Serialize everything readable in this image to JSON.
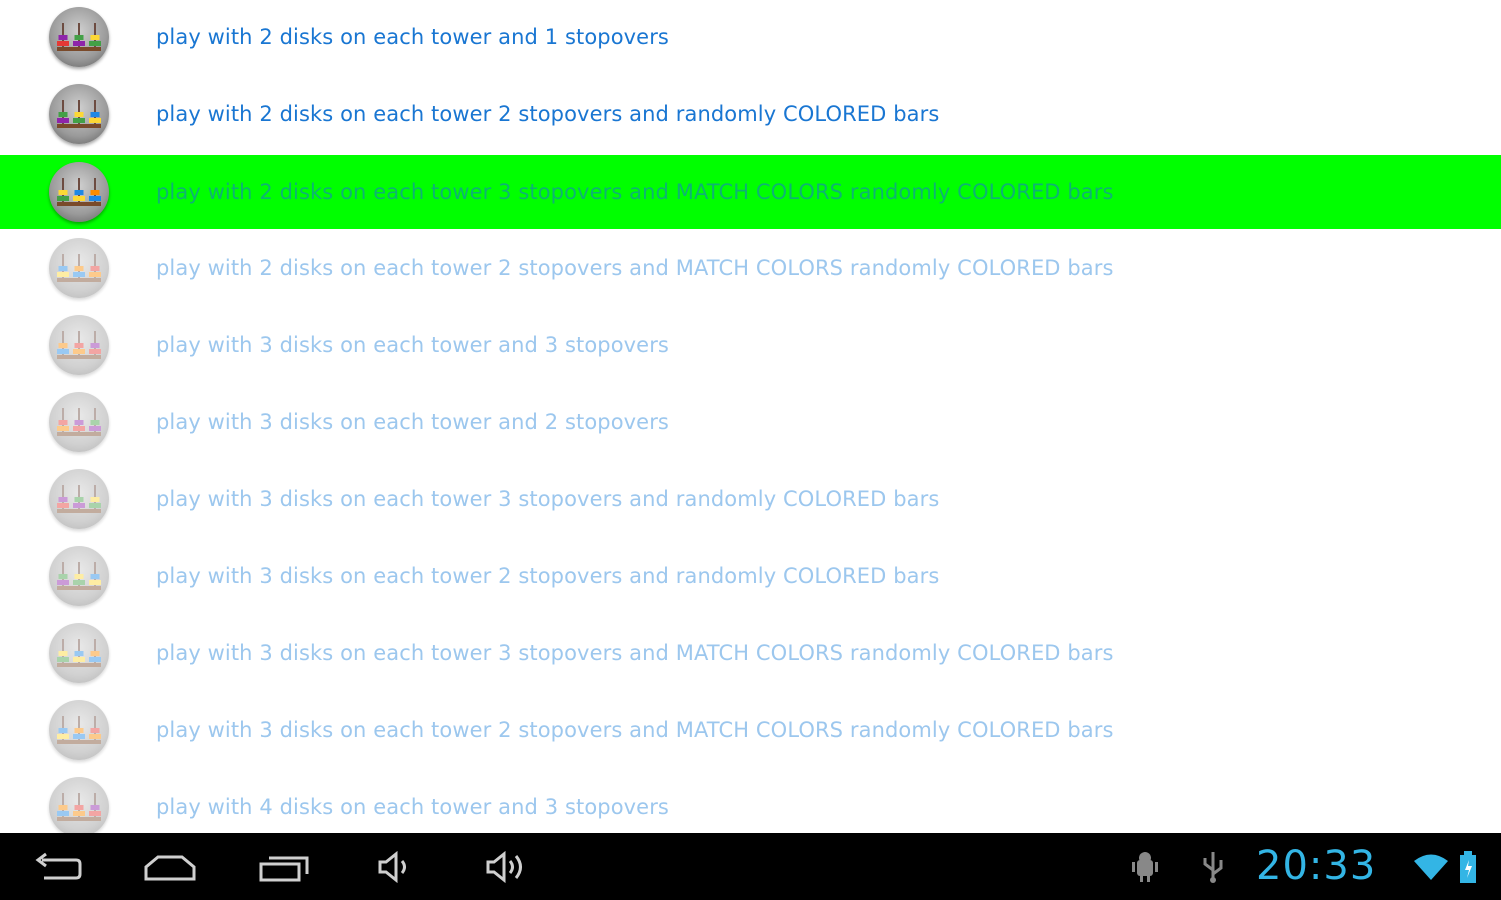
{
  "list": {
    "items": [
      {
        "label": "play with 2 disks on each tower and 1 stopovers",
        "state": "normal"
      },
      {
        "label": "play with 2 disks on each tower 2 stopovers and randomly COLORED bars",
        "state": "normal"
      },
      {
        "label": "play with 2 disks on each tower 3 stopovers and MATCH COLORS randomly COLORED bars",
        "state": "selected"
      },
      {
        "label": "play with 2 disks on each tower 2 stopovers and MATCH COLORS randomly COLORED bars",
        "state": "faded"
      },
      {
        "label": "play with 3 disks on each tower and 3 stopovers",
        "state": "faded"
      },
      {
        "label": "play with 3 disks on each tower and 2 stopovers",
        "state": "faded"
      },
      {
        "label": "play with 3 disks on each tower 3 stopovers and randomly COLORED bars",
        "state": "faded"
      },
      {
        "label": "play with 3 disks on each tower 2 stopovers and randomly COLORED bars",
        "state": "faded"
      },
      {
        "label": "play with 3 disks on each tower 3 stopovers and MATCH COLORS randomly COLORED bars",
        "state": "faded"
      },
      {
        "label": "play with 3 disks on each tower 2 stopovers and MATCH COLORS randomly COLORED bars",
        "state": "faded"
      },
      {
        "label": "play with 4 disks on each tower and 3 stopovers",
        "state": "faded"
      }
    ]
  },
  "navbar": {
    "buttons": [
      {
        "name": "back-icon"
      },
      {
        "name": "home-icon"
      },
      {
        "name": "recent-apps-icon"
      },
      {
        "name": "volume-down-icon"
      },
      {
        "name": "volume-up-icon"
      }
    ],
    "status": {
      "icons": [
        "android-debug-icon",
        "usb-icon",
        "wifi-icon",
        "battery-icon"
      ],
      "clock": "20:33"
    }
  },
  "colors": {
    "selected_row": "#00ff00",
    "link_text": "#1976d2",
    "faded_text": "#9cc7ee",
    "clock": "#33b5e5",
    "navbar_bg": "#000000"
  }
}
